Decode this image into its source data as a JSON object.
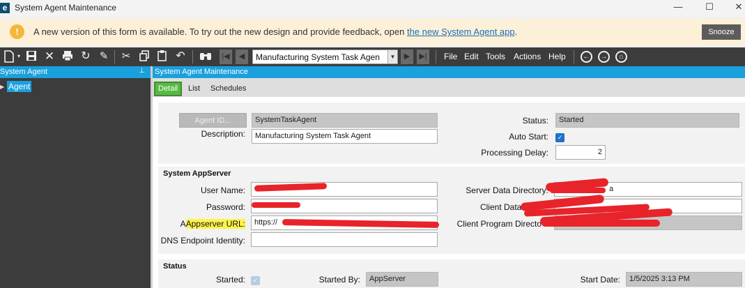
{
  "window": {
    "logo_letter": "e",
    "title": "System Agent Maintenance",
    "minimize": "—",
    "maximize": "☐",
    "close": "✕"
  },
  "banner": {
    "icon": "!",
    "text": "A new version of this form is available. To try out the new design and provide feedback, open ",
    "link": "the new System Agent app",
    "suffix": ".",
    "snooze": "Snooze"
  },
  "toolbar": {
    "record_selector": "Manufacturing System Task Agen",
    "menus": [
      "File",
      "Edit",
      "Tools",
      "Actions",
      "Help"
    ],
    "icons": [
      "new-icon",
      "save-icon",
      "delete-icon",
      "print-icon",
      "refresh-icon",
      "clear-icon",
      "cut-icon",
      "copy-icon",
      "paste-icon",
      "undo-icon",
      "search-icon",
      "first-icon",
      "prev-icon",
      "next-icon",
      "last-icon",
      "back-icon",
      "forward-icon",
      "home-icon"
    ]
  },
  "left_panel": {
    "title": "System Agent",
    "tree_item": "Agent"
  },
  "main": {
    "title": "System Agent Maintenance",
    "tabs": [
      "Detail",
      "List",
      "Schedules"
    ],
    "agent": {
      "agent_id_button": "Agent ID...",
      "agent_id": "SystemTaskAgent",
      "description_label": "Description:",
      "description": "Manufacturing System Task Agent",
      "status_label": "Status:",
      "status": "Started",
      "auto_start_label": "Auto Start:",
      "auto_start": true,
      "processing_delay_label": "Processing Delay:",
      "processing_delay": "2"
    },
    "appserver": {
      "title": "System AppServer",
      "user_name_label": "User Name:",
      "password_label": "Password:",
      "appserver_url_label_hl": "Appserver URL:",
      "appserver_url": "https://",
      "dns_label": "DNS Endpoint Identity:",
      "dns": "",
      "server_data_dir_label": "Server Data Directory:",
      "server_data_dir_tail": "a",
      "client_data_dir_label": "Client Data Dir",
      "client_program_dir_label": "Client Program Directo"
    },
    "status_group": {
      "title": "Status",
      "started_label": "Started:",
      "started": true,
      "started_by_label": "Started By:",
      "started_by": "AppServer",
      "start_date_label": "Start Date:",
      "start_date": "1/5/2025 3:13 PM"
    }
  },
  "colors": {
    "accent": "#1aa0dd",
    "toolbar": "#3c3c3c",
    "active_tab": "#58b947",
    "banner": "#fdf0d8",
    "redaction": "#e8232a",
    "highlight": "#fff44a"
  }
}
